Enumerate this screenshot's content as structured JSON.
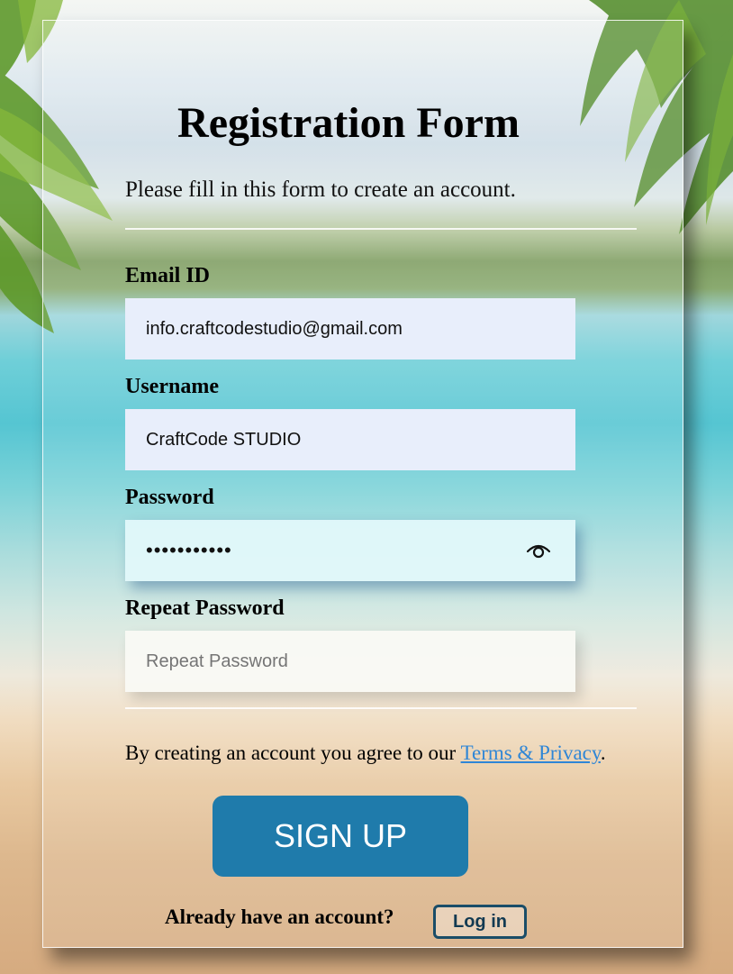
{
  "form": {
    "title": "Registration Form",
    "subtitle": "Please fill in this form to create an account.",
    "fields": {
      "email": {
        "label": "Email ID",
        "value": "info.craftcodestudio@gmail.com"
      },
      "username": {
        "label": "Username",
        "value": "CraftCode STUDIO"
      },
      "password": {
        "label": "Password",
        "value": "•••••••••••",
        "icon": "eye-icon"
      },
      "repeat_password": {
        "label": "Repeat Password",
        "value": "",
        "placeholder": "Repeat Password"
      }
    },
    "terms": {
      "text": "By creating an account you agree to our ",
      "link_text": "Terms & Privacy",
      "suffix": "."
    },
    "signup_label": "SIGN UP",
    "login_prompt": "Already have an account?",
    "login_label": "Log in"
  },
  "colors": {
    "signup_button": "#1f7bab",
    "link": "#2f86d6",
    "login_border": "#1a4d68",
    "input_background": "#e8eefb"
  }
}
